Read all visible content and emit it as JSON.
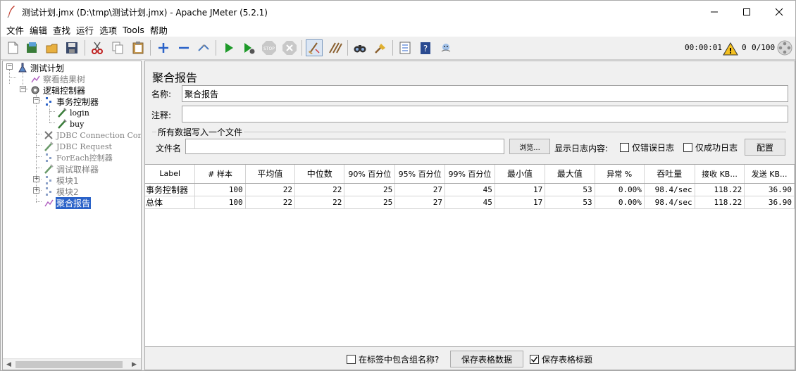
{
  "window": {
    "title": "测试计划.jmx (D:\\tmp\\测试计划.jmx) - Apache JMeter (5.2.1)"
  },
  "menu": [
    "文件",
    "编辑",
    "查找",
    "运行",
    "选项",
    "Tools",
    "帮助"
  ],
  "toolbar": {
    "icons": [
      "new-icon",
      "templates-icon",
      "open-icon",
      "save-icon",
      "cut-icon",
      "copy-icon",
      "paste-icon",
      "expand-icon",
      "collapse-icon",
      "toggle-icon",
      "start-icon",
      "start-no-pause-icon",
      "stop-icon",
      "shutdown-icon",
      "clear-icon",
      "clear-all-icon",
      "search-icon",
      "reset-search-icon",
      "function-helper-icon",
      "help-icon",
      "remote-icon"
    ],
    "elapsed": "00:00:01",
    "warnings": "0",
    "threads": "0/100"
  },
  "tree": {
    "nodes": [
      {
        "label": "测试计划",
        "icon": "test-plan-icon"
      },
      {
        "label": "察看结果树",
        "icon": "listener-icon"
      },
      {
        "label": "逻辑控制器",
        "icon": "controller-icon"
      },
      {
        "label": "事务控制器",
        "icon": "controller-icon"
      },
      {
        "label": "login",
        "icon": "sampler-icon"
      },
      {
        "label": "buy",
        "icon": "sampler-icon"
      },
      {
        "label": "JDBC Connection Con",
        "icon": "config-icon"
      },
      {
        "label": "JDBC Request",
        "icon": "sampler-icon"
      },
      {
        "label": "ForEach控制器",
        "icon": "controller-icon"
      },
      {
        "label": "调试取样器",
        "icon": "sampler-icon"
      },
      {
        "label": "模块1",
        "icon": "controller-icon"
      },
      {
        "label": "模块2",
        "icon": "controller-icon"
      },
      {
        "label": "聚合报告",
        "icon": "listener-icon"
      }
    ]
  },
  "panel": {
    "title": "聚合报告",
    "name_label": "名称:",
    "name_value": "聚合报告",
    "comment_label": "注释:",
    "comment_value": "",
    "fileset_legend": "所有数据写入一个文件",
    "file_label": "文件名",
    "file_value": "",
    "browse_button": "浏览...",
    "log_label": "显示日志内容:",
    "errors_only": "仅错误日志",
    "success_only": "仅成功日志",
    "configure_button": "配置"
  },
  "table": {
    "columns": [
      "Label",
      "# 样本",
      "平均值",
      "中位数",
      "90% 百分位",
      "95% 百分位",
      "99% 百分位",
      "最小值",
      "最大值",
      "异常 %",
      "吞吐量",
      "接收 KB...",
      "发送 KB..."
    ],
    "rows": [
      [
        "事务控制器",
        "100",
        "22",
        "22",
        "25",
        "27",
        "45",
        "17",
        "53",
        "0.00%",
        "98.4/sec",
        "118.22",
        "36.90"
      ],
      [
        "总体",
        "100",
        "22",
        "22",
        "25",
        "27",
        "45",
        "17",
        "53",
        "0.00%",
        "98.4/sec",
        "118.22",
        "36.90"
      ]
    ]
  },
  "bottom": {
    "include_group": "在标签中包含组名称?",
    "save_table": "保存表格数据",
    "save_header": "保存表格标题"
  }
}
